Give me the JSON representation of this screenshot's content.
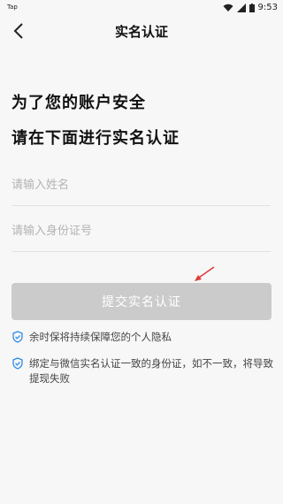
{
  "statusbar": {
    "app": "Tap",
    "time": "9:53"
  },
  "header": {
    "title": "实名认证"
  },
  "headline": {
    "line1": "为了您的账户安全",
    "line2": "请在下面进行实名认证"
  },
  "form": {
    "name_placeholder": "请输入姓名",
    "id_placeholder": "请输入身份证号",
    "submit_label": "提交实名认证"
  },
  "notes": [
    "余时保将持续保障您的个人隐私",
    "绑定与微信实名认证一致的身份证，如不一致，将导致提现失败"
  ],
  "colors": {
    "shield": "#2f8be6",
    "arrow": "#e23b3b",
    "button": "#cbcbcb"
  }
}
